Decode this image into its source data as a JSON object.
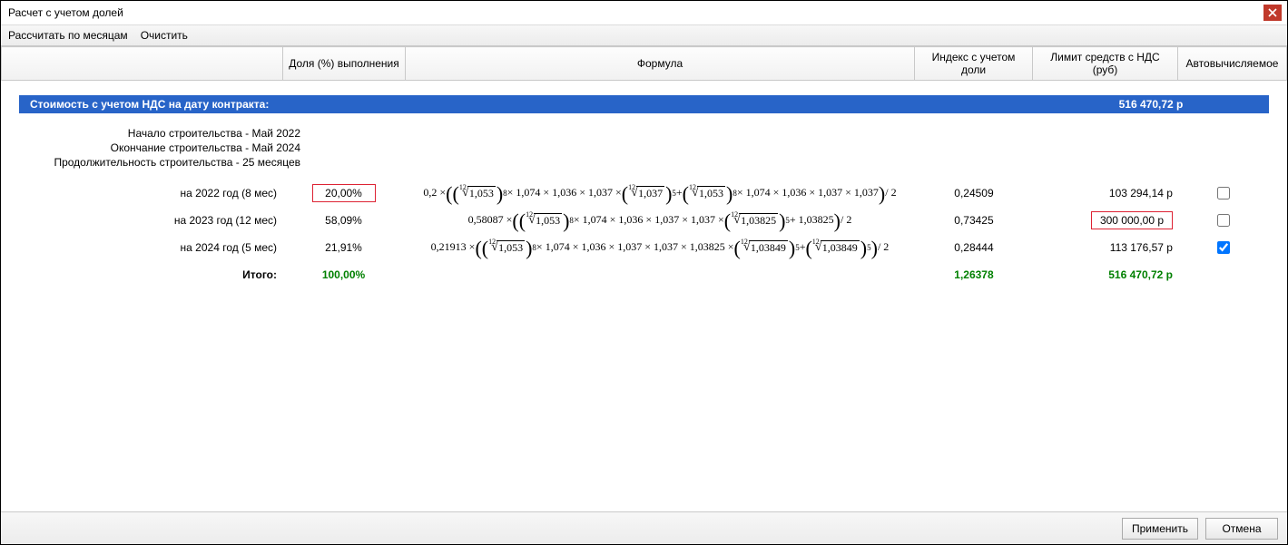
{
  "window": {
    "title": "Расчет с учетом долей"
  },
  "menu": {
    "calc": "Рассчитать по месяцам",
    "clear": "Очистить"
  },
  "columns": {
    "label": "",
    "pct": "Доля (%) выполнения",
    "formula": "Формула",
    "index": "Индекс с учетом доли",
    "limit": "Лимит средств с НДС (руб)",
    "auto": "Автовычисляемое"
  },
  "banner": {
    "label": "Стоимость  с  учетом НДС на дату  контракта:",
    "value": "516 470,72 р"
  },
  "meta": {
    "start": "Начало строительства - Май 2022",
    "end": "Окончание строительства - Май 2024",
    "dur": "Продолжительность строительства - 25 месяцев"
  },
  "rows": [
    {
      "label": "на 2022 год (8 мес)",
      "pct": "20,00%",
      "pct_boxed": true,
      "index": "0,24509",
      "limit": "103 294,14 р",
      "limit_boxed": false,
      "auto": false,
      "formula": {
        "lead": "0,2 ×",
        "half": "/ 2",
        "groups": [
          {
            "deg": "12",
            "rad": "1,053",
            "outer_pow": "8",
            "tail": "× 1,074 × 1,036 × 1,037 ×"
          },
          {
            "deg": "12",
            "rad": "1,037",
            "outer_pow": "5",
            "tail": "+"
          },
          {
            "deg": "12",
            "rad": "1,053",
            "outer_pow": "8",
            "tail": "× 1,074 × 1,036 × 1,037 × 1,037"
          }
        ]
      }
    },
    {
      "label": "на 2023 год (12 мес)",
      "pct": "58,09%",
      "pct_boxed": false,
      "index": "0,73425",
      "limit": "300 000,00 р",
      "limit_boxed": true,
      "auto": false,
      "formula": {
        "lead": "0,58087 ×",
        "half": "/ 2",
        "groups": [
          {
            "deg": "12",
            "rad": "1,053",
            "outer_pow": "8",
            "tail": "× 1,074 × 1,036 × 1,037 × 1,037 ×"
          },
          {
            "deg": "12",
            "rad": "1,03825",
            "outer_pow": "5",
            "tail": "+ 1,03825"
          }
        ]
      }
    },
    {
      "label": "на 2024 год (5 мес)",
      "pct": "21,91%",
      "pct_boxed": false,
      "index": "0,28444",
      "limit": "113 176,57 р",
      "limit_boxed": false,
      "auto": true,
      "formula": {
        "lead": "0,21913 ×",
        "half": "/ 2",
        "groups": [
          {
            "deg": "12",
            "rad": "1,053",
            "outer_pow": "8",
            "tail": "× 1,074 × 1,036 × 1,037 × 1,037 × 1,03825 ×"
          },
          {
            "deg": "12",
            "rad": "1,03849",
            "outer_pow": "5",
            "tail": "+"
          },
          {
            "deg": "12",
            "rad": "1,03849",
            "outer_pow": "5",
            "tail": ""
          }
        ]
      }
    }
  ],
  "total": {
    "label": "Итого:",
    "pct": "100,00%",
    "index": "1,26378",
    "limit": "516 470,72 р"
  },
  "buttons": {
    "apply": "Применить",
    "cancel": "Отмена"
  }
}
